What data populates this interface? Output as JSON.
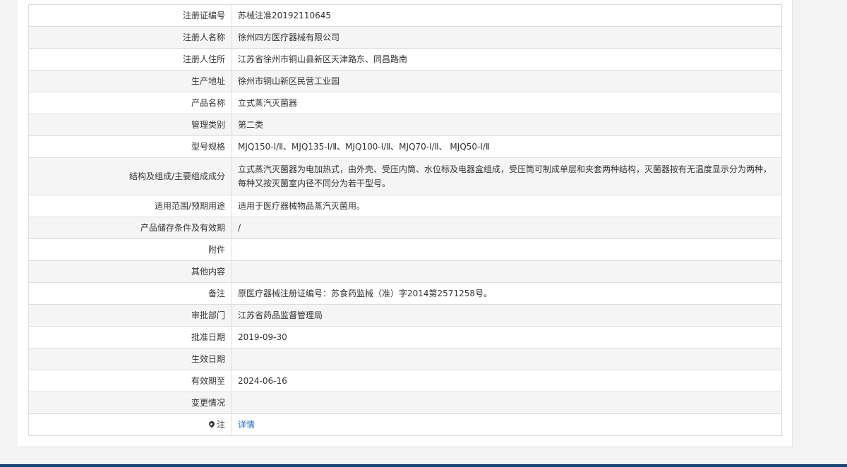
{
  "rows": [
    {
      "label": "注册证编号",
      "value": "苏械注准20192110645"
    },
    {
      "label": "注册人名称",
      "value": "徐州四方医疗器械有限公司"
    },
    {
      "label": "注册人住所",
      "value": "江苏省徐州市铜山县新区天津路东、同昌路南"
    },
    {
      "label": "生产地址",
      "value": "徐州市铜山新区民营工业园"
    },
    {
      "label": "产品名称",
      "value": "立式蒸汽灭菌器"
    },
    {
      "label": "管理类别",
      "value": "第二类"
    },
    {
      "label": "型号规格",
      "value": "MJQ150-Ⅰ/Ⅱ、MJQ135-Ⅰ/Ⅱ、MJQ100-Ⅰ/Ⅱ、MJQ70-Ⅰ/Ⅱ、 MJQ50-Ⅰ/Ⅱ"
    },
    {
      "label": "结构及组成/主要组成成分",
      "value": "立式蒸汽灭菌器为电加热式，由外壳、受压内筒、水位标及电器盒组成，受压筒可制成单层和夹套两种结构，灭菌器按有无温度显示分为两种，每种又按灭菌室内径不同分为若干型号。"
    },
    {
      "label": "适用范围/预期用途",
      "value": "适用于医疗器械物品蒸汽灭菌用。"
    },
    {
      "label": "产品储存条件及有效期",
      "value": "/"
    },
    {
      "label": "附件",
      "value": ""
    },
    {
      "label": "其他内容",
      "value": ""
    },
    {
      "label": "备注",
      "value": "原医疗器械注册证编号：苏食药监械（准）字2014第2571258号。"
    },
    {
      "label": "审批部门",
      "value": "江苏省药品监督管理局"
    },
    {
      "label": "批准日期",
      "value": "2019-09-30"
    },
    {
      "label": "生效日期",
      "value": ""
    },
    {
      "label": "有效期至",
      "value": "2024-06-16"
    },
    {
      "label": "变更情况",
      "value": ""
    }
  ],
  "note_row": {
    "icon": "map-marker-icon",
    "label": "注",
    "link_text": "详情",
    "link_color": "#2a6dc6"
  }
}
